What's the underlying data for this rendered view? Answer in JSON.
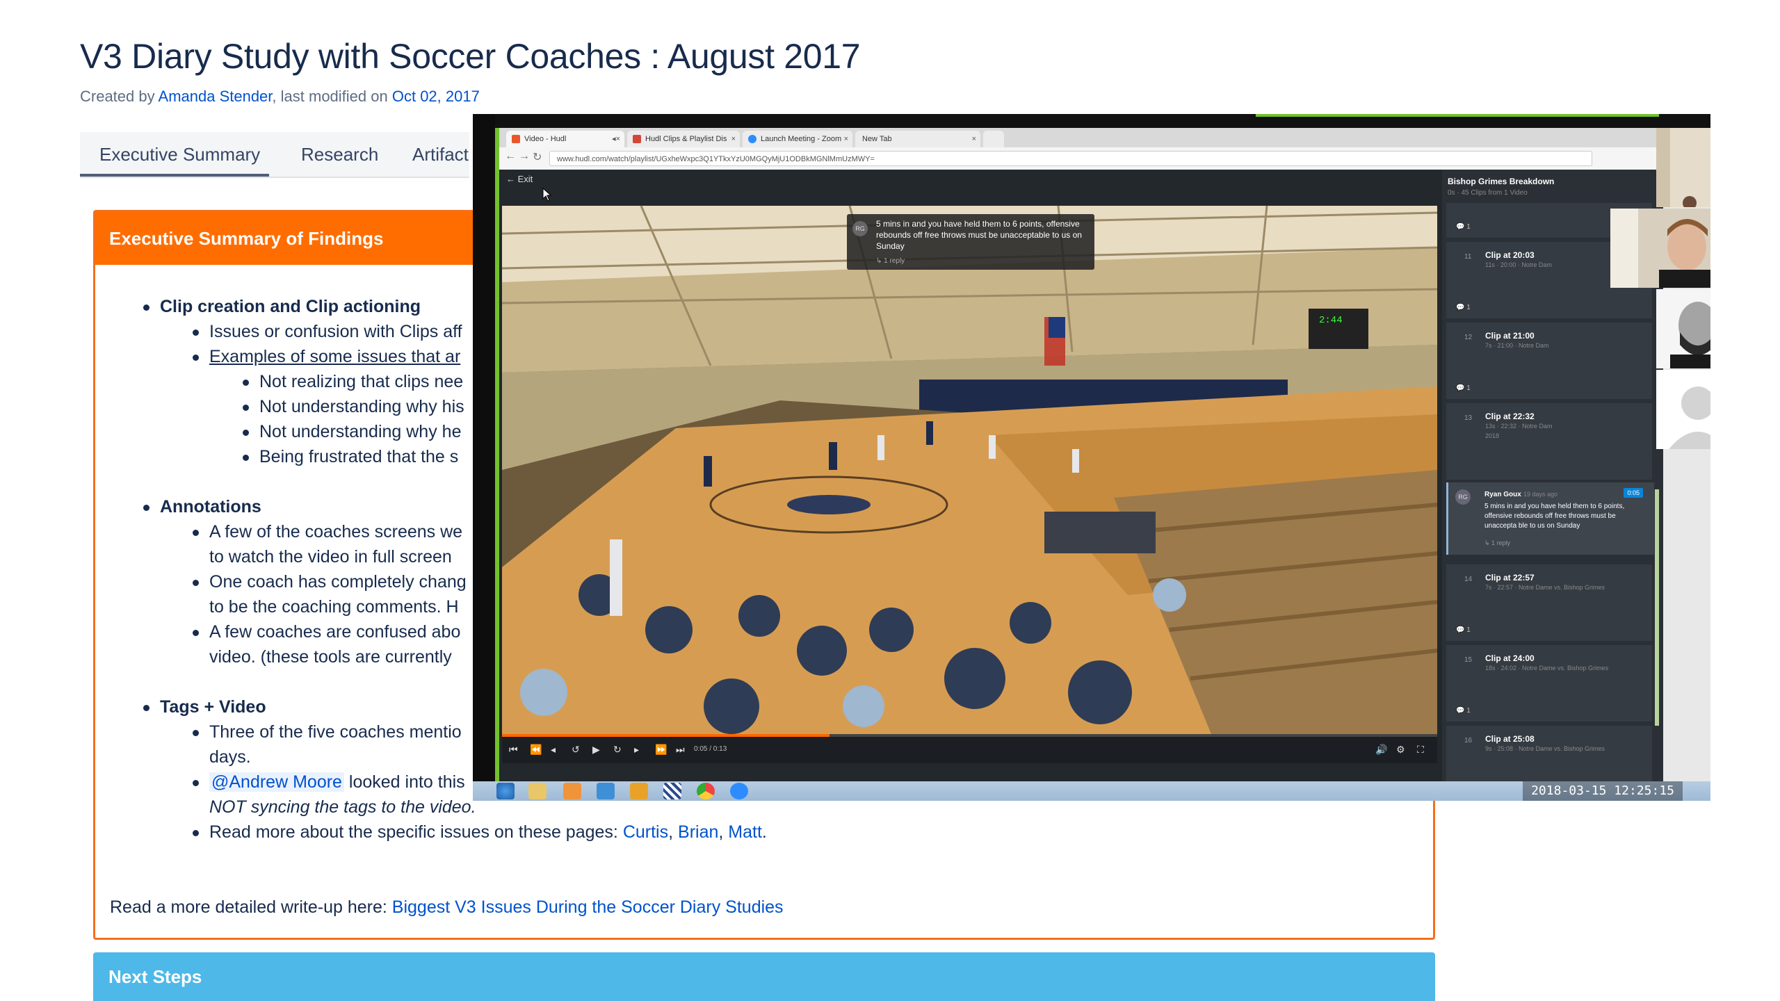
{
  "page": {
    "title": "V3 Diary Study with Soccer Coaches : August 2017",
    "byline": {
      "created_by_prefix": "Created by ",
      "author": "Amanda Stender",
      "modified_prefix": ", last modified on ",
      "date": "Oct 02, 2017"
    },
    "tabs": [
      {
        "label": "Executive Summary",
        "active": true
      },
      {
        "label": "Research"
      },
      {
        "label": "Artifact"
      }
    ]
  },
  "findings": {
    "header": "Executive Summary of Findings",
    "clip": {
      "title": "Clip creation and Clip actioning",
      "item1": "Issues or confusion with Clips aff",
      "item2": "Examples of some issues that ar",
      "sub1": "Not realizing that clips nee",
      "sub2": "Not understanding why his",
      "sub3": "Not understanding why he",
      "sub4": "Being frustrated that the s"
    },
    "annotations": {
      "title": "Annotations",
      "item1a": "A few of the coaches screens we",
      "item1b": "to watch the video in full screen",
      "item2a": "One coach has completely chang",
      "item2b": "to be the coaching comments. H",
      "item3a": "A few coaches are confused abo",
      "item3b": "video. (these tools are currently"
    },
    "tags": {
      "title": "Tags + Video",
      "item1a": "Three of the five coaches mentio",
      "item1b": "days.",
      "mention": "@Andrew Moore",
      "item2a": " looked into this",
      "item2b": "NOT syncing the tags to the video.",
      "item3_prefix": "Read more about the specific issues on these pages: ",
      "links": [
        "Curtis",
        "Brian",
        "Matt"
      ],
      "sep": ", ",
      "end": "."
    },
    "writeup_prefix": "Read a more detailed write-up here: ",
    "writeup_link": "Biggest V3 Issues During the Soccer Diary Studies"
  },
  "next_steps": {
    "header": "Next Steps"
  },
  "overlay": {
    "browser_tabs": [
      {
        "label": "Video - Hudl",
        "color": "#e8562a"
      },
      {
        "label": "Hudl Clips & Playlist Dis",
        "color": "#d44638"
      },
      {
        "label": "Launch Meeting - Zoom",
        "color": "#2d8cff"
      },
      {
        "label": "New Tab",
        "color": "#cccccc"
      }
    ],
    "url": "www.hudl.com/watch/playlist/UGxheWxpc3Q1YTkxYzU0MGQyMjU1ODBkMGNlMmUzMWY=",
    "exit": "Exit",
    "comment": {
      "avatar": "RG",
      "text": "5 mins in and you have held them to 6 points, offensive rebounds off free throws must be unacceptable to us on Sunday",
      "reply": "↳ 1 reply"
    },
    "timecode": "0:05 / 0:13",
    "progress": 0.35,
    "sidebar": {
      "title": "Bishop Grimes Breakdown",
      "subtitle": "0s · 45 Clips from 1 Video",
      "clips": [
        {
          "num": "11",
          "title": "Clip at 20:03",
          "meta": "11s · 20:00 · Notre Dam"
        },
        {
          "num": "12",
          "title": "Clip at 21:00",
          "meta": "7s · 21:00 · Notre Dam"
        },
        {
          "num": "13",
          "title": "Clip at 22:32",
          "meta": "13s · 22:32 · Notre Dam"
        },
        {
          "num": "14",
          "title": "Clip at 22:57",
          "meta": "7s · 22:57 · Notre Dame vs. Bishop Grimes"
        },
        {
          "num": "15",
          "title": "Clip at 24:00",
          "meta": "18s · 24:02 · Notre Dame vs. Bishop Grimes"
        },
        {
          "num": "16",
          "title": "Clip at 25:08",
          "meta": "9s · 25:08 · Notre Dame vs. Bishop Grimes"
        }
      ],
      "comment_count": "1",
      "selected_comment": {
        "avatar": "RG",
        "name": "Ryan Goux",
        "ago": "19 days ago",
        "tag": "0:05",
        "text": "5 mins in and you have held them to 6 points, offensive rebounds off free throws must be unaccepta ble to us on Sunday",
        "reply": "↳ 1 reply"
      },
      "clip13_meta2": "2018"
    },
    "timestamp": "2018-03-15  12:25:15"
  },
  "colors": {
    "link": "#0052cc",
    "findings_orange": "#ff6d00",
    "next_steps_blue": "#4eb8e8",
    "hudl_accent": "#ff6600",
    "browser_green": "#72c12d"
  }
}
